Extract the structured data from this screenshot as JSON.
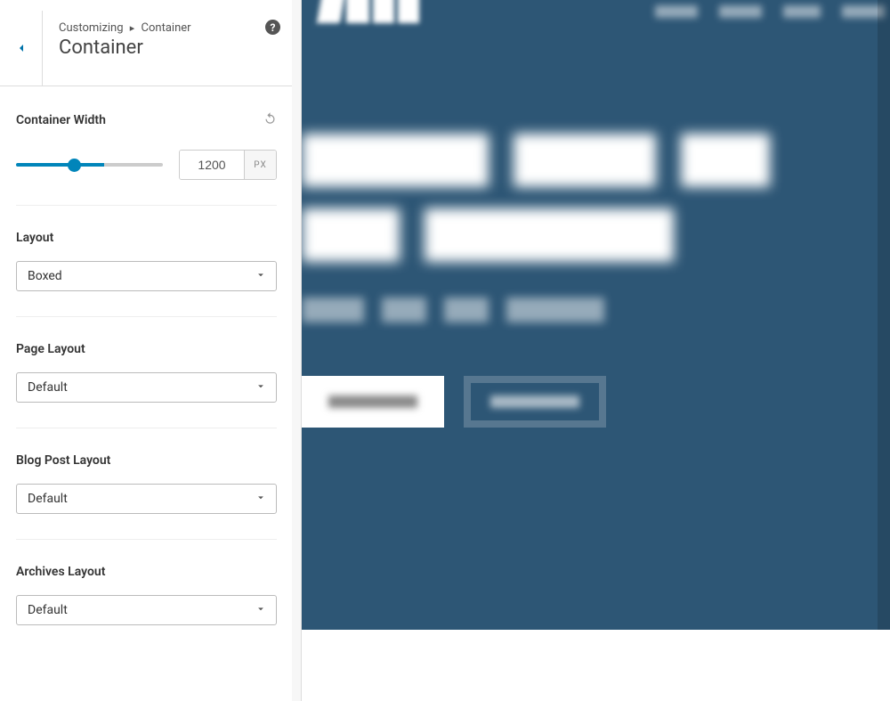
{
  "header": {
    "breadcrumb_prefix": "Customizing",
    "breadcrumb_current": "Container",
    "panel_title": "Container",
    "help_tooltip": "?"
  },
  "controls": {
    "container_width": {
      "label": "Container Width",
      "value": "1200",
      "unit": "PX"
    },
    "layout": {
      "label": "Layout",
      "value": "Boxed"
    },
    "page_layout": {
      "label": "Page Layout",
      "value": "Default"
    },
    "blog_post_layout": {
      "label": "Blog Post Layout",
      "value": "Default"
    },
    "archives_layout": {
      "label": "Archives Layout",
      "value": "Default"
    }
  },
  "icons": {
    "back": "chevron-left",
    "reset": "reset",
    "dropdown": "chevron-down",
    "help": "help"
  }
}
